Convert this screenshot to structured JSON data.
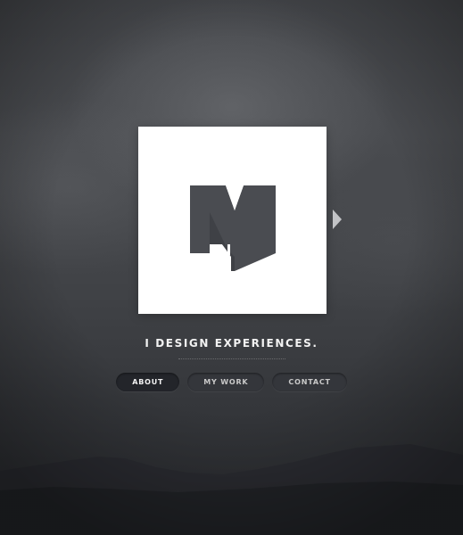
{
  "hero": {
    "tagline": "I DESIGN EXPERIENCES."
  },
  "logo": {
    "icon": "m-monogram-logo",
    "card_color": "#ffffff",
    "mark_color": "#4a4c51"
  },
  "slider": {
    "next_icon": "triangle-right-icon"
  },
  "nav": {
    "items": [
      {
        "label": "ABOUT",
        "active": true
      },
      {
        "label": "MY WORK",
        "active": false
      },
      {
        "label": "CONTACT",
        "active": false
      }
    ]
  },
  "colors": {
    "background": "#404246",
    "text": "#f2f2f2",
    "button": "#34363b",
    "button_active": "#23252a"
  }
}
